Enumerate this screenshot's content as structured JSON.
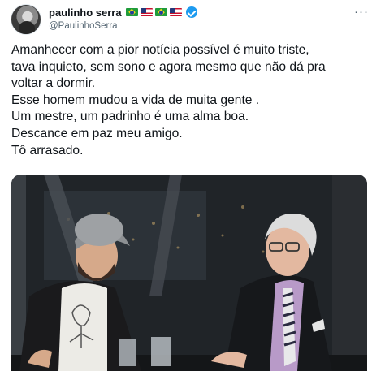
{
  "header": {
    "display_name": "paulinho serra",
    "handle": "@PaulinhoSerra",
    "flags": [
      "brazil-flag",
      "us-flag",
      "brazil-flag",
      "us-flag"
    ],
    "verified": true,
    "more_label": "···"
  },
  "tweet": {
    "lines": [
      "Amanhecer com a pior notícia possível é muito triste,",
      "tava inquieto, sem sono e agora mesmo que não dá pra",
      "voltar a dormir.",
      "Esse homem mudou a vida de muita gente .",
      "Um mestre, um padrinho é uma alma boa.",
      "Descance em paz meu amigo.",
      "Tô arrasado."
    ]
  },
  "colors": {
    "text": "#0f1419",
    "secondary": "#536471",
    "verified": "#1d9bf0"
  }
}
